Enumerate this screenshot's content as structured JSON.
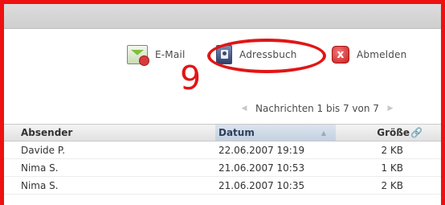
{
  "toolbar": {
    "email_label": "E-Mail",
    "addressbook_label": "Adressbuch",
    "logout_label": "Abmelden",
    "logout_glyph": "x"
  },
  "annotation": {
    "number": "9"
  },
  "pager": {
    "prev_glyph": "◀",
    "next_glyph": "▶",
    "text": "Nachrichten 1 bis 7 von 7"
  },
  "table": {
    "headers": {
      "sender": "Absender",
      "date": "Datum",
      "size": "Größe"
    },
    "rows": [
      {
        "sender": "Davide P.",
        "date": "22.06.2007 19:19",
        "size": "2 KB"
      },
      {
        "sender": "Nima S.",
        "date": "21.06.2007 10:53",
        "size": "1 KB"
      },
      {
        "sender": "Nima S.",
        "date": "21.06.2007 10:35",
        "size": "2 KB"
      }
    ]
  },
  "colors": {
    "annotation_red": "#e21515",
    "header_sorted": "#c5d1e0"
  }
}
